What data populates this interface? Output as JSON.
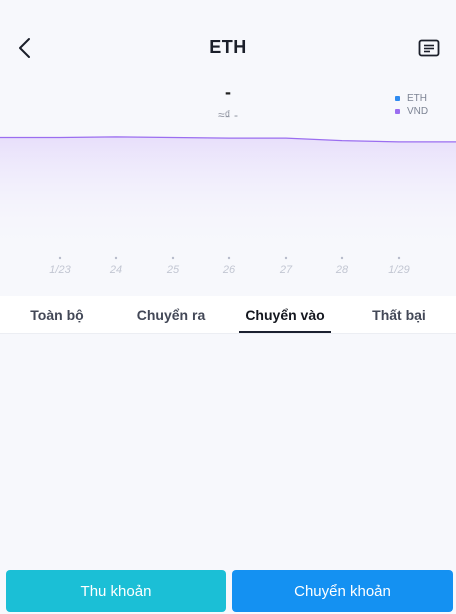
{
  "header": {
    "title": "ETH"
  },
  "price": {
    "main": "-",
    "sub": "≈₫ -"
  },
  "legend": [
    {
      "name": "ETH",
      "color": "#2f8bf0"
    },
    {
      "name": "VND",
      "color": "#9b6ef0"
    }
  ],
  "chart_data": {
    "type": "area",
    "x": [
      "1/23",
      "24",
      "25",
      "26",
      "27",
      "28",
      "1/29"
    ],
    "series": [
      {
        "name": "VND",
        "color": "#9b6ef0",
        "values": [
          0.94,
          0.945,
          0.94,
          0.935,
          0.935,
          0.915,
          0.905
        ]
      }
    ],
    "ylim": [
      0,
      1
    ],
    "grid": false
  },
  "tabs": [
    {
      "label": "Toàn bộ",
      "active": false
    },
    {
      "label": "Chuyển ra",
      "active": false
    },
    {
      "label": "Chuyển vào",
      "active": true
    },
    {
      "label": "Thất bại",
      "active": false
    }
  ],
  "actions": {
    "receive_label": "Thu khoản",
    "transfer_label": "Chuyển khoản"
  },
  "colors": {
    "receive": "#1bbfd6",
    "transfer": "#1491f2",
    "line": "#9b6ef0"
  }
}
